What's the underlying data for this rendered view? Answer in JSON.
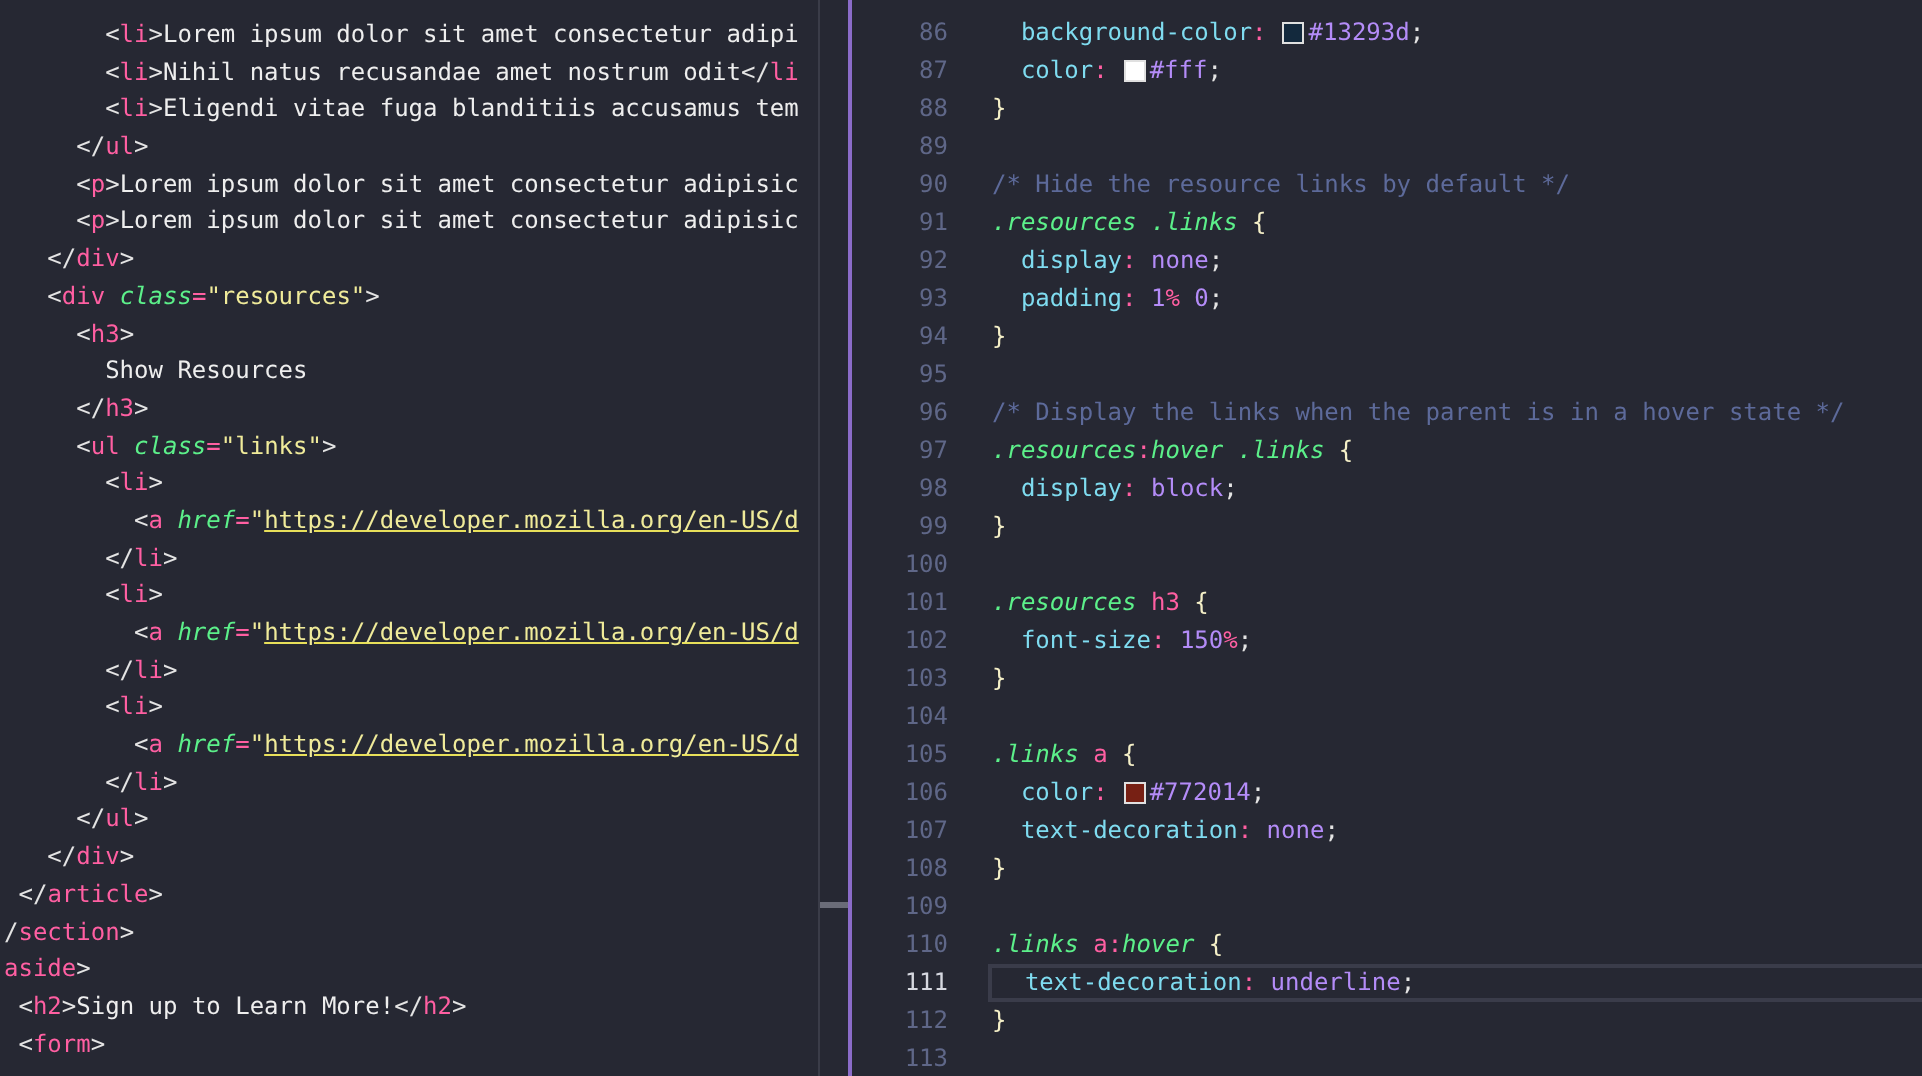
{
  "left_editor": {
    "lines": [
      {
        "tokens": [
          {
            "kind": "punct",
            "text": "       <"
          },
          {
            "kind": "tag",
            "text": "li"
          },
          {
            "kind": "punct",
            "text": ">"
          },
          {
            "kind": "text",
            "text": "Lorem ipsum dolor sit amet consectetur adipi"
          }
        ]
      },
      {
        "tokens": [
          {
            "kind": "punct",
            "text": "       <"
          },
          {
            "kind": "tag",
            "text": "li"
          },
          {
            "kind": "punct",
            "text": ">"
          },
          {
            "kind": "text",
            "text": "Nihil natus recusandae amet nostrum odit"
          },
          {
            "kind": "punct",
            "text": "</"
          },
          {
            "kind": "tag",
            "text": "li"
          }
        ]
      },
      {
        "tokens": [
          {
            "kind": "punct",
            "text": "       <"
          },
          {
            "kind": "tag",
            "text": "li"
          },
          {
            "kind": "punct",
            "text": ">"
          },
          {
            "kind": "text",
            "text": "Eligendi vitae fuga blanditiis accusamus tem"
          }
        ]
      },
      {
        "tokens": [
          {
            "kind": "punct",
            "text": "     </"
          },
          {
            "kind": "tag",
            "text": "ul"
          },
          {
            "kind": "punct",
            "text": ">"
          }
        ]
      },
      {
        "tokens": [
          {
            "kind": "punct",
            "text": "     <"
          },
          {
            "kind": "tag",
            "text": "p"
          },
          {
            "kind": "punct",
            "text": ">"
          },
          {
            "kind": "text",
            "text": "Lorem ipsum dolor sit amet consectetur adipisic"
          }
        ]
      },
      {
        "tokens": [
          {
            "kind": "punct",
            "text": "     <"
          },
          {
            "kind": "tag",
            "text": "p"
          },
          {
            "kind": "punct",
            "text": ">"
          },
          {
            "kind": "text",
            "text": "Lorem ipsum dolor sit amet consectetur adipisic"
          }
        ]
      },
      {
        "tokens": [
          {
            "kind": "punct",
            "text": "   </"
          },
          {
            "kind": "tag",
            "text": "div"
          },
          {
            "kind": "punct",
            "text": ">"
          }
        ]
      },
      {
        "tokens": [
          {
            "kind": "punct",
            "text": "   <"
          },
          {
            "kind": "tag",
            "text": "div"
          },
          {
            "kind": "attr",
            "text": " class"
          },
          {
            "kind": "eq",
            "text": "="
          },
          {
            "kind": "string",
            "text": "\"resources\""
          },
          {
            "kind": "punct",
            "text": ">"
          }
        ]
      },
      {
        "tokens": [
          {
            "kind": "punct",
            "text": "     <"
          },
          {
            "kind": "tag",
            "text": "h3"
          },
          {
            "kind": "punct",
            "text": ">"
          }
        ]
      },
      {
        "tokens": [
          {
            "kind": "text",
            "text": "       Show Resources"
          }
        ]
      },
      {
        "tokens": [
          {
            "kind": "punct",
            "text": "     </"
          },
          {
            "kind": "tag",
            "text": "h3"
          },
          {
            "kind": "punct",
            "text": ">"
          }
        ]
      },
      {
        "tokens": [
          {
            "kind": "punct",
            "text": "     <"
          },
          {
            "kind": "tag",
            "text": "ul"
          },
          {
            "kind": "attr",
            "text": " class"
          },
          {
            "kind": "eq",
            "text": "="
          },
          {
            "kind": "string",
            "text": "\"links\""
          },
          {
            "kind": "punct",
            "text": ">"
          }
        ]
      },
      {
        "tokens": [
          {
            "kind": "punct",
            "text": "       <"
          },
          {
            "kind": "tag",
            "text": "li"
          },
          {
            "kind": "punct",
            "text": ">"
          }
        ]
      },
      {
        "tokens": [
          {
            "kind": "punct",
            "text": "         <"
          },
          {
            "kind": "tag",
            "text": "a"
          },
          {
            "kind": "attr",
            "text": " href"
          },
          {
            "kind": "eq",
            "text": "="
          },
          {
            "kind": "string",
            "text": "\""
          },
          {
            "kind": "link",
            "text": "https://developer.mozilla.org/en-US/d"
          }
        ]
      },
      {
        "tokens": [
          {
            "kind": "punct",
            "text": "       </"
          },
          {
            "kind": "tag",
            "text": "li"
          },
          {
            "kind": "punct",
            "text": ">"
          }
        ]
      },
      {
        "tokens": [
          {
            "kind": "punct",
            "text": "       <"
          },
          {
            "kind": "tag",
            "text": "li"
          },
          {
            "kind": "punct",
            "text": ">"
          }
        ]
      },
      {
        "tokens": [
          {
            "kind": "punct",
            "text": "         <"
          },
          {
            "kind": "tag",
            "text": "a"
          },
          {
            "kind": "attr",
            "text": " href"
          },
          {
            "kind": "eq",
            "text": "="
          },
          {
            "kind": "string",
            "text": "\""
          },
          {
            "kind": "link",
            "text": "https://developer.mozilla.org/en-US/d"
          }
        ]
      },
      {
        "tokens": [
          {
            "kind": "punct",
            "text": "       </"
          },
          {
            "kind": "tag",
            "text": "li"
          },
          {
            "kind": "punct",
            "text": ">"
          }
        ]
      },
      {
        "tokens": [
          {
            "kind": "punct",
            "text": "       <"
          },
          {
            "kind": "tag",
            "text": "li"
          },
          {
            "kind": "punct",
            "text": ">"
          }
        ]
      },
      {
        "tokens": [
          {
            "kind": "punct",
            "text": "         <"
          },
          {
            "kind": "tag",
            "text": "a"
          },
          {
            "kind": "attr",
            "text": " href"
          },
          {
            "kind": "eq",
            "text": "="
          },
          {
            "kind": "string",
            "text": "\""
          },
          {
            "kind": "link",
            "text": "https://developer.mozilla.org/en-US/d"
          }
        ]
      },
      {
        "tokens": [
          {
            "kind": "punct",
            "text": "       </"
          },
          {
            "kind": "tag",
            "text": "li"
          },
          {
            "kind": "punct",
            "text": ">"
          }
        ]
      },
      {
        "tokens": [
          {
            "kind": "punct",
            "text": "     </"
          },
          {
            "kind": "tag",
            "text": "ul"
          },
          {
            "kind": "punct",
            "text": ">"
          }
        ]
      },
      {
        "tokens": [
          {
            "kind": "punct",
            "text": "   </"
          },
          {
            "kind": "tag",
            "text": "div"
          },
          {
            "kind": "punct",
            "text": ">"
          }
        ]
      },
      {
        "tokens": [
          {
            "kind": "punct",
            "text": " </"
          },
          {
            "kind": "tag",
            "text": "article"
          },
          {
            "kind": "punct",
            "text": ">"
          }
        ]
      },
      {
        "tokens": [
          {
            "kind": "punct",
            "text": "/"
          },
          {
            "kind": "tag",
            "text": "section"
          },
          {
            "kind": "punct",
            "text": ">"
          }
        ]
      },
      {
        "tokens": [
          {
            "kind": "tag",
            "text": "aside"
          },
          {
            "kind": "punct",
            "text": ">"
          }
        ]
      },
      {
        "tokens": [
          {
            "kind": "punct",
            "text": " <"
          },
          {
            "kind": "tag",
            "text": "h2"
          },
          {
            "kind": "punct",
            "text": ">"
          },
          {
            "kind": "text",
            "text": "Sign up to Learn More!"
          },
          {
            "kind": "punct",
            "text": "</"
          },
          {
            "kind": "tag",
            "text": "h2"
          },
          {
            "kind": "punct",
            "text": ">"
          }
        ]
      },
      {
        "tokens": [
          {
            "kind": "punct",
            "text": " <"
          },
          {
            "kind": "tag",
            "text": "form"
          },
          {
            "kind": "punct",
            "text": ">"
          }
        ]
      }
    ]
  },
  "right_editor": {
    "lines": [
      {
        "number": "86",
        "current": false,
        "tokens": [
          {
            "kind": "property",
            "text": "  background-color"
          },
          {
            "kind": "colon",
            "text": ":"
          },
          {
            "kind": "swatch",
            "color": "#13293d"
          },
          {
            "kind": "value",
            "text": "#13293d"
          },
          {
            "kind": "punct",
            "text": ";"
          }
        ]
      },
      {
        "number": "87",
        "current": false,
        "tokens": [
          {
            "kind": "property",
            "text": "  color"
          },
          {
            "kind": "colon",
            "text": ":"
          },
          {
            "kind": "swatch",
            "color": "#ffffff"
          },
          {
            "kind": "value",
            "text": "#fff"
          },
          {
            "kind": "punct",
            "text": ";"
          }
        ]
      },
      {
        "number": "88",
        "current": false,
        "tokens": [
          {
            "kind": "brace",
            "text": "}"
          }
        ]
      },
      {
        "number": "89",
        "current": false
      },
      {
        "number": "90",
        "current": false,
        "tokens": [
          {
            "kind": "comment",
            "text": "/* Hide the resource links by default */"
          }
        ]
      },
      {
        "number": "91",
        "current": false,
        "tokens": [
          {
            "kind": "selector",
            "text": ".resources"
          },
          {
            "kind": "selector",
            "text": " .links"
          },
          {
            "kind": "brace",
            "text": " {"
          }
        ]
      },
      {
        "number": "92",
        "current": false,
        "tokens": [
          {
            "kind": "property",
            "text": "  display"
          },
          {
            "kind": "colon",
            "text": ":"
          },
          {
            "kind": "value",
            "text": " none"
          },
          {
            "kind": "punct",
            "text": ";"
          }
        ]
      },
      {
        "number": "93",
        "current": false,
        "tokens": [
          {
            "kind": "property",
            "text": "  padding"
          },
          {
            "kind": "colon",
            "text": ":"
          },
          {
            "kind": "number",
            "text": " 1"
          },
          {
            "kind": "unit",
            "text": "%"
          },
          {
            "kind": "number",
            "text": " 0"
          },
          {
            "kind": "punct",
            "text": ";"
          }
        ]
      },
      {
        "number": "94",
        "current": false,
        "tokens": [
          {
            "kind": "brace",
            "text": "}"
          }
        ]
      },
      {
        "number": "95",
        "current": false
      },
      {
        "number": "96",
        "current": false,
        "tokens": [
          {
            "kind": "comment",
            "text": "/* Display the links when the parent is in a hover state */"
          }
        ]
      },
      {
        "number": "97",
        "current": false,
        "tokens": [
          {
            "kind": "selector",
            "text": ".resources"
          },
          {
            "kind": "colon",
            "text": ":"
          },
          {
            "kind": "selector",
            "text": "hover"
          },
          {
            "kind": "selector",
            "text": " .links"
          },
          {
            "kind": "brace",
            "text": " {"
          }
        ]
      },
      {
        "number": "98",
        "current": false,
        "tokens": [
          {
            "kind": "property",
            "text": "  display"
          },
          {
            "kind": "colon",
            "text": ":"
          },
          {
            "kind": "value",
            "text": " block"
          },
          {
            "kind": "punct",
            "text": ";"
          }
        ]
      },
      {
        "number": "99",
        "current": false,
        "tokens": [
          {
            "kind": "brace",
            "text": "}"
          }
        ]
      },
      {
        "number": "100",
        "current": false
      },
      {
        "number": "101",
        "current": false,
        "tokens": [
          {
            "kind": "selector",
            "text": ".resources"
          },
          {
            "kind": "tag",
            "text": " h3"
          },
          {
            "kind": "brace",
            "text": " {"
          }
        ]
      },
      {
        "number": "102",
        "current": false,
        "tokens": [
          {
            "kind": "property",
            "text": "  font-size"
          },
          {
            "kind": "colon",
            "text": ":"
          },
          {
            "kind": "number",
            "text": " 150"
          },
          {
            "kind": "unit",
            "text": "%"
          },
          {
            "kind": "punct",
            "text": ";"
          }
        ]
      },
      {
        "number": "103",
        "current": false,
        "tokens": [
          {
            "kind": "brace",
            "text": "}"
          }
        ]
      },
      {
        "number": "104",
        "current": false
      },
      {
        "number": "105",
        "current": false,
        "tokens": [
          {
            "kind": "selector",
            "text": ".links"
          },
          {
            "kind": "tag",
            "text": " a"
          },
          {
            "kind": "brace",
            "text": " {"
          }
        ]
      },
      {
        "number": "106",
        "current": false,
        "tokens": [
          {
            "kind": "property",
            "text": "  color"
          },
          {
            "kind": "colon",
            "text": ":"
          },
          {
            "kind": "swatch",
            "color": "#772014"
          },
          {
            "kind": "value",
            "text": "#772014"
          },
          {
            "kind": "punct",
            "text": ";"
          }
        ]
      },
      {
        "number": "107",
        "current": false,
        "tokens": [
          {
            "kind": "property",
            "text": "  text-decoration"
          },
          {
            "kind": "colon",
            "text": ":"
          },
          {
            "kind": "value",
            "text": " none"
          },
          {
            "kind": "punct",
            "text": ";"
          }
        ]
      },
      {
        "number": "108",
        "current": false,
        "tokens": [
          {
            "kind": "brace",
            "text": "}"
          }
        ]
      },
      {
        "number": "109",
        "current": false
      },
      {
        "number": "110",
        "current": false,
        "tokens": [
          {
            "kind": "selector",
            "text": ".links"
          },
          {
            "kind": "tag",
            "text": " a"
          },
          {
            "kind": "colon",
            "text": ":"
          },
          {
            "kind": "selector",
            "text": "hover"
          },
          {
            "kind": "brace",
            "text": " {"
          }
        ]
      },
      {
        "number": "111",
        "current": true,
        "tokens": [
          {
            "kind": "property",
            "text": "  text-decoration"
          },
          {
            "kind": "colon",
            "text": ":"
          },
          {
            "kind": "value",
            "text": " underline"
          },
          {
            "kind": "punct",
            "text": ";"
          }
        ]
      },
      {
        "number": "112",
        "current": false,
        "tokens": [
          {
            "kind": "brace",
            "text": "}"
          }
        ]
      },
      {
        "number": "113",
        "current": false
      }
    ]
  }
}
